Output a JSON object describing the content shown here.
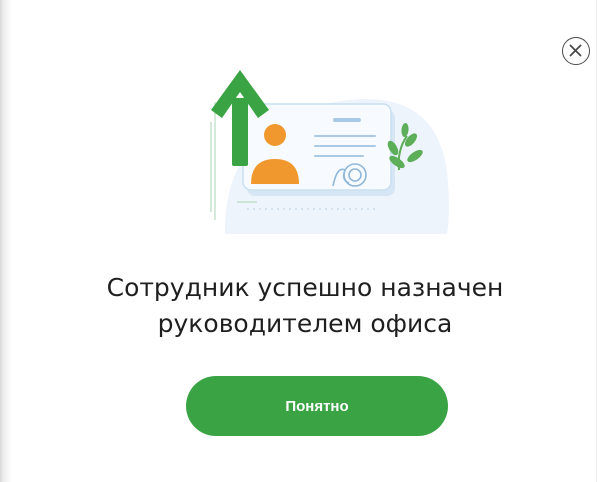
{
  "dialog": {
    "message_line_1": "Сотрудник успешно назначен",
    "message_line_2": "руководителем офиса",
    "ok_button_label": "Понятно",
    "close_icon": "close-icon",
    "illustration_icon": "promotion-id-card-illustration"
  },
  "colors": {
    "accent_green": "#3aa444",
    "text": "#1f1f1f",
    "avatar_orange": "#f0982e"
  }
}
